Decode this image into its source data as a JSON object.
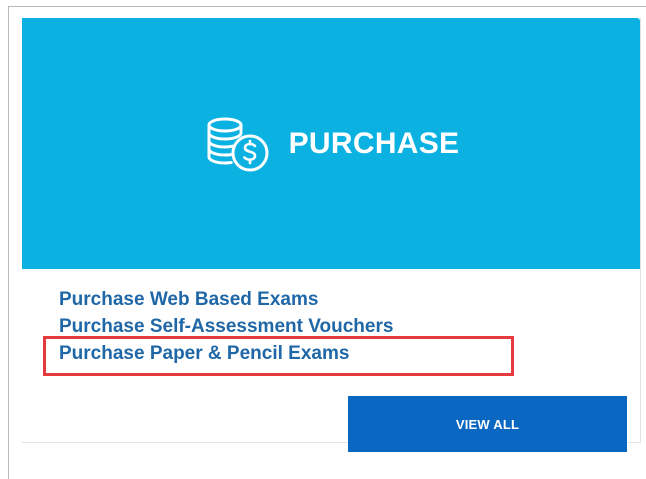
{
  "card": {
    "title": "PURCHASE",
    "icon": "coins-dollar-icon",
    "links": [
      "Purchase Web Based Exams",
      "Purchase Self-Assessment Vouchers",
      "Purchase Paper & Pencil Exams"
    ],
    "view_all_label": "VIEW ALL",
    "highlighted_link_index": 1
  },
  "colors": {
    "hero_background": "#0bb1e1",
    "link_text": "#1f67a6",
    "button_background": "#0a67c2",
    "highlight_border": "#e53b40"
  }
}
